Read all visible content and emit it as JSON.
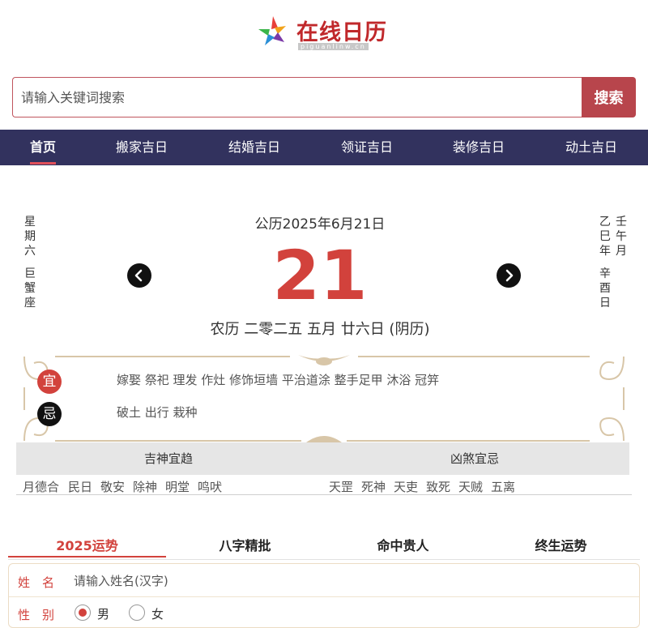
{
  "site": {
    "title": "在线日历",
    "subtitle": "piguanlinw.cn"
  },
  "search": {
    "placeholder": "请输入关键词搜索",
    "button_label": "搜索"
  },
  "nav": {
    "items": [
      "首页",
      "搬家吉日",
      "结婚吉日",
      "领证吉日",
      "装修吉日",
      "动土吉日"
    ],
    "active_index": 0
  },
  "date": {
    "weekday_chars": [
      "星",
      "期",
      "六"
    ],
    "constellation_chars": [
      "巨",
      "蟹",
      "座"
    ],
    "ganzhi_year": [
      "乙",
      "巳",
      "年"
    ],
    "ganzhi_month": [
      "壬",
      "午",
      "月"
    ],
    "ganzhi_day": [
      "辛",
      "酉",
      "日"
    ],
    "gregorian": "公历2025年6月21日",
    "day": "21",
    "lunar": "农历 二零二五 五月 廿六日 (阴历)",
    "prev_icon": "chevron-left-icon",
    "next_icon": "chevron-right-icon"
  },
  "yiji": {
    "yi_label": "宜",
    "yi_items": "嫁娶 祭祀 理发 作灶 修饰垣墙 平治道涂 整手足甲 沐浴 冠笄",
    "ji_label": "忌",
    "ji_items": "破土 出行 栽种"
  },
  "gods": {
    "good_header": "吉神宜趋",
    "bad_header": "凶煞宜忌",
    "good": [
      "月德合",
      "民日",
      "敬安",
      "除神",
      "明堂",
      "鸣吠"
    ],
    "bad": [
      "天罡",
      "死神",
      "天吏",
      "致死",
      "天贼",
      "五离"
    ]
  },
  "tabs": {
    "items": [
      "2025运势",
      "八字精批",
      "命中贵人",
      "终生运势"
    ],
    "active_index": 0
  },
  "form": {
    "name_label": "姓　名",
    "name_placeholder": "请输入姓名(汉字)",
    "gender_label": "性　别",
    "male": "男",
    "female": "女",
    "selected_gender": "男"
  },
  "colors": {
    "accent_red": "#d2423c",
    "nav_bg": "#32325e",
    "search_button": "#b8454c",
    "ji_badge": "#111111"
  }
}
